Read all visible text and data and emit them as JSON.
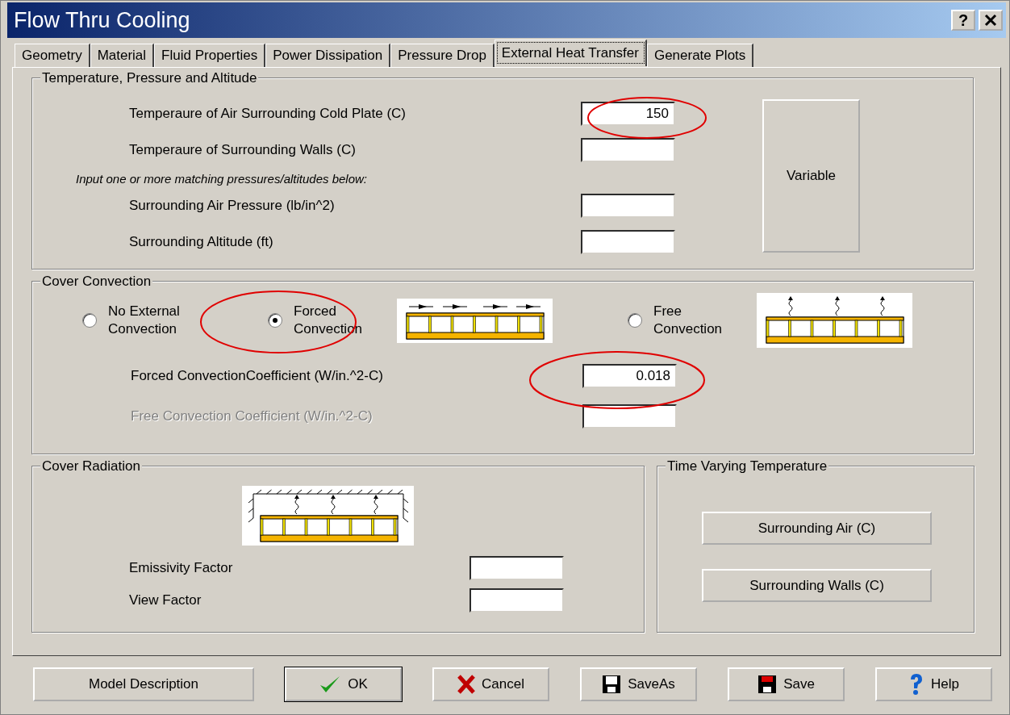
{
  "window": {
    "title": "Flow Thru Cooling",
    "help_button": "?"
  },
  "tabs": [
    {
      "label": "Geometry",
      "selected": false
    },
    {
      "label": "Material",
      "selected": false
    },
    {
      "label": "Fluid Properties",
      "selected": false
    },
    {
      "label": "Power Dissipation",
      "selected": false
    },
    {
      "label": "Pressure Drop",
      "selected": false
    },
    {
      "label": "External Heat Transfer",
      "selected": true
    },
    {
      "label": "Generate Plots",
      "selected": false
    }
  ],
  "temperature_group": {
    "title": "Temperature, Pressure and Altitude",
    "items": [
      {
        "kind": "field",
        "label": "Temperaure of Air Surrounding Cold Plate (C)",
        "value": "150"
      },
      {
        "kind": "field",
        "label": "Temperaure of Surrounding Walls (C)"
      },
      {
        "kind": "note",
        "label": "Input one or more matching pressures/altitudes below:"
      },
      {
        "kind": "field",
        "label": "Surrounding Air Pressure (lb/in^2)"
      },
      {
        "kind": "field",
        "label": "Surrounding Altitude (ft)"
      }
    ],
    "variable_button": "Variable"
  },
  "convection_group": {
    "title": "Cover Convection",
    "options": [
      {
        "label": "No External Convection",
        "selected": false
      },
      {
        "label": "Forced Convection",
        "selected": true
      },
      {
        "label": "Free Convection",
        "selected": false
      }
    ],
    "fields": [
      {
        "label": "Forced ConvectionCoefficient (W/in.^2-C)",
        "value": "0.018",
        "disabled": false
      },
      {
        "label": "Free Convection Coefficient (W/in.^2-C)",
        "disabled": true
      }
    ]
  },
  "radiation_group": {
    "title": "Cover Radiation",
    "fields": [
      {
        "label": "Emissivity Factor"
      },
      {
        "label": "View Factor"
      }
    ]
  },
  "time_group": {
    "title": "Time Varying Temperature",
    "buttons": [
      "Surrounding Air (C)",
      "Surrounding Walls (C)"
    ]
  },
  "buttons": [
    {
      "label": "Model Description",
      "kind": "plain",
      "default": false
    },
    {
      "label": "OK",
      "kind": "ok",
      "default": true
    },
    {
      "label": "Cancel",
      "kind": "cancel",
      "default": false
    },
    {
      "label": "SaveAs",
      "kind": "saveas",
      "default": false
    },
    {
      "label": "Save",
      "kind": "save",
      "default": false
    },
    {
      "label": "Help",
      "kind": "help",
      "default": false
    }
  ]
}
